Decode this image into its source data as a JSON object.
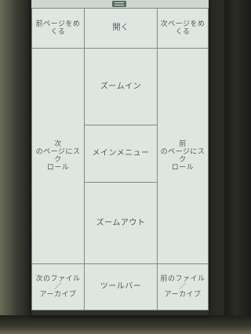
{
  "zones": {
    "top_left": "前ページをめくる",
    "top_center": "開く",
    "top_right": "次ページをめくる",
    "zoom_in": "ズームイン",
    "left_scroll": "次\nのページにスク\nロール",
    "main_menu": "メインメニュー",
    "right_scroll": "前\nのページにスク\nロール",
    "zoom_out": "ズームアウト",
    "bottom_left": "次のファイル／\nアーカイブ",
    "toolbar": "ツールバー",
    "bottom_right": "前のファイル／\nアーカイブ"
  }
}
